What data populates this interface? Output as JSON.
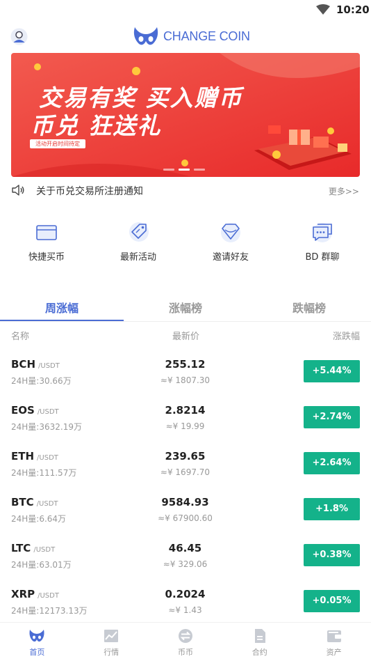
{
  "status_bar": {
    "time": "10:20"
  },
  "header": {
    "logo_text": "CHANGE COIN"
  },
  "banner": {
    "headline_line1": "交易有奖 买入赠币",
    "headline_line2": "币兑 狂送礼",
    "tag": "活动开启时间待定",
    "active_slide": 2,
    "slide_count": 3
  },
  "notice": {
    "text": "关于币兑交易所注册通知",
    "more": "更多>>"
  },
  "quick_actions": [
    {
      "label": "快捷买币",
      "icon": "card-icon"
    },
    {
      "label": "最新活动",
      "icon": "tag-icon"
    },
    {
      "label": "邀请好友",
      "icon": "diamond-icon"
    },
    {
      "label": "BD 群聊",
      "icon": "chat-icon"
    }
  ],
  "tabs": [
    {
      "label": "周涨幅",
      "active": true
    },
    {
      "label": "涨幅榜",
      "active": false
    },
    {
      "label": "跌幅榜",
      "active": false
    }
  ],
  "columns": {
    "name": "名称",
    "price": "最新价",
    "change": "涨跌幅"
  },
  "rows": [
    {
      "symbol": "BCH",
      "pair": "/USDT",
      "volume": "24H量:30.66万",
      "price": "255.12",
      "cny": "≈¥ 1807.30",
      "change": "+5.44%"
    },
    {
      "symbol": "EOS",
      "pair": "/USDT",
      "volume": "24H量:3632.19万",
      "price": "2.8214",
      "cny": "≈¥ 19.99",
      "change": "+2.74%"
    },
    {
      "symbol": "ETH",
      "pair": "/USDT",
      "volume": "24H量:111.57万",
      "price": "239.65",
      "cny": "≈¥ 1697.70",
      "change": "+2.64%"
    },
    {
      "symbol": "BTC",
      "pair": "/USDT",
      "volume": "24H量:6.64万",
      "price": "9584.93",
      "cny": "≈¥ 67900.60",
      "change": "+1.8%"
    },
    {
      "symbol": "LTC",
      "pair": "/USDT",
      "volume": "24H量:63.01万",
      "price": "46.45",
      "cny": "≈¥ 329.06",
      "change": "+0.38%"
    },
    {
      "symbol": "XRP",
      "pair": "/USDT",
      "volume": "24H量:12173.13万",
      "price": "0.2024",
      "cny": "≈¥ 1.43",
      "change": "+0.05%"
    }
  ],
  "tabbar": [
    {
      "label": "首页",
      "icon": "home-logo-icon",
      "active": true
    },
    {
      "label": "行情",
      "icon": "chart-icon",
      "active": false
    },
    {
      "label": "币币",
      "icon": "exchange-icon",
      "active": false
    },
    {
      "label": "合约",
      "icon": "document-icon",
      "active": false
    },
    {
      "label": "资产",
      "icon": "wallet-icon",
      "active": false
    }
  ],
  "colors": {
    "accent": "#4a6cd4",
    "up": "#14b28a",
    "banner_red": "#ee3b3b"
  }
}
